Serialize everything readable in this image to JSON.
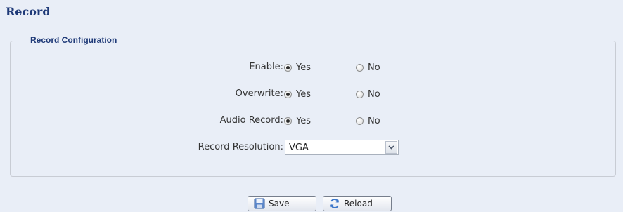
{
  "page": {
    "title": "Record"
  },
  "fieldset": {
    "legend": "Record Configuration"
  },
  "rows": [
    {
      "label": "Enable:",
      "yes_label": "Yes",
      "no_label": "No",
      "selected": "Yes"
    },
    {
      "label": "Overwrite:",
      "yes_label": "Yes",
      "no_label": "No",
      "selected": "Yes"
    },
    {
      "label": "Audio Record:",
      "yes_label": "Yes",
      "no_label": "No",
      "selected": "Yes"
    }
  ],
  "resolution": {
    "label": "Record Resolution:",
    "value": "VGA"
  },
  "buttons": {
    "save": "Save",
    "reload": "Reload"
  },
  "icons": {
    "save": "floppy-disk-icon",
    "reload": "refresh-icon",
    "dropdown": "chevron-down-icon"
  }
}
